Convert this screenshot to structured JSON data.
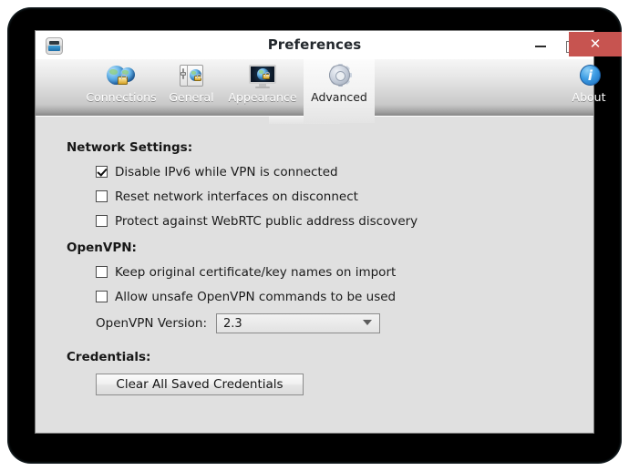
{
  "window": {
    "title": "Preferences",
    "icon": "vpn-app-icon",
    "controls": {
      "minimize": "minimize-icon",
      "maximize": "maximize-icon",
      "close_label": "✕",
      "close_color": "#c75450"
    }
  },
  "toolbar": {
    "tabs": [
      {
        "id": "connections",
        "label": "Connections",
        "icon": "globes-lock-icon",
        "active": false
      },
      {
        "id": "general",
        "label": "General",
        "icon": "settings-panel-globe-icon",
        "active": false
      },
      {
        "id": "appearance",
        "label": "Appearance",
        "icon": "monitor-globe-icon",
        "active": false
      },
      {
        "id": "advanced",
        "label": "Advanced",
        "icon": "gear-icon",
        "active": true
      }
    ],
    "about": {
      "label": "About",
      "icon": "info-circle-icon"
    }
  },
  "content": {
    "sections": [
      {
        "id": "network-settings",
        "heading": "Network Settings:",
        "checkboxes": [
          {
            "id": "disable-ipv6",
            "label": "Disable IPv6 while VPN is connected",
            "checked": true
          },
          {
            "id": "reset-network-interfaces",
            "label": "Reset network interfaces on disconnect",
            "checked": false
          },
          {
            "id": "protect-webrtc",
            "label": "Protect against WebRTC public address discovery",
            "checked": false
          }
        ]
      },
      {
        "id": "openvpn",
        "heading": "OpenVPN:",
        "checkboxes": [
          {
            "id": "keep-original-cert-names",
            "label": "Keep original certificate/key names on import",
            "checked": false
          },
          {
            "id": "allow-unsafe-commands",
            "label": "Allow unsafe OpenVPN commands to be used",
            "checked": false
          }
        ],
        "select": {
          "id": "openvpn-version",
          "label": "OpenVPN Version:",
          "value": "2.3"
        }
      },
      {
        "id": "credentials",
        "heading": "Credentials:",
        "button": {
          "id": "clear-saved-credentials",
          "label": "Clear All Saved Credentials"
        }
      }
    ]
  },
  "theme": {
    "content_bg": "#e0e0e0",
    "titlebar_bg": "#ffffff",
    "close_red": "#c75450",
    "text": "#1b1b1b"
  }
}
